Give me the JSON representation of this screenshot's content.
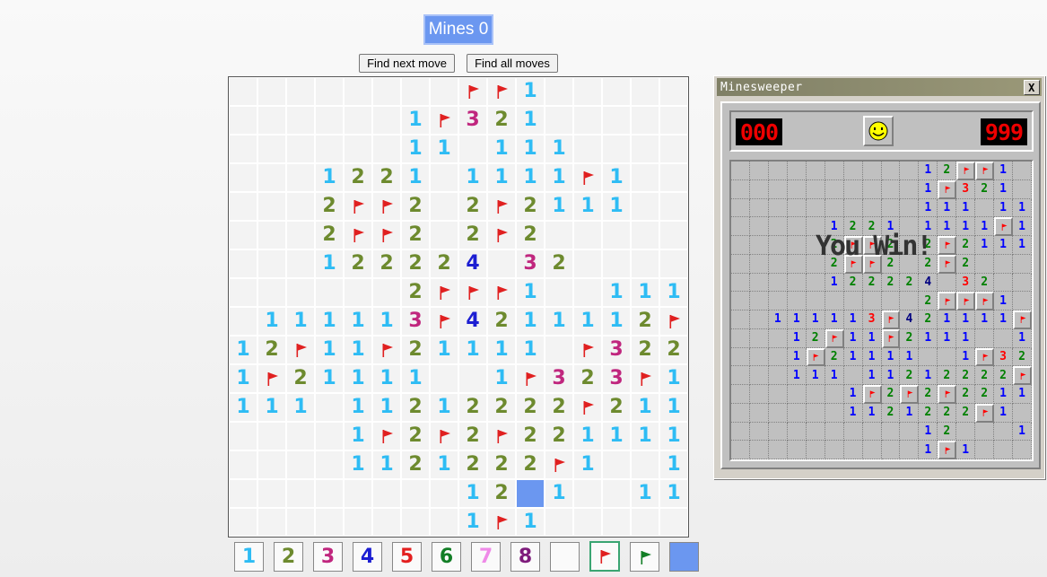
{
  "header": {
    "mines_label": "Mines 0",
    "find_next_label": "Find next move",
    "find_all_label": "Find all moves"
  },
  "colors": {
    "1": "#2ebcf4",
    "2": "#6d8a2e",
    "3": "#c0267e",
    "4": "#1c1ed2",
    "5": "#e31f1f",
    "6": "#127e26",
    "7": "#ef8ae8",
    "8": "#7e1b7b",
    "flag": "#e02020",
    "highlight": "#6b97f0",
    "selected_border": "#3aa572"
  },
  "board": [
    "......._FF1.....",
    "......1F321.....",
    "......11.111....",
    "...1221.1111F1..",
    "...2FF2.2F2111..",
    "...2FF2.2F2.....",
    "...122224.32....",
    "......2FFF1..111",
    ".111113F4211112F1",
    "12F11F21111.F322",
    "1F21111..1F323F1",
    "111.11212222F211",
    "....1F2F2F221111",
    "....1121222F1..1F",
    "........12S1..11",
    "........1F1....."
  ],
  "palette": [
    "1",
    "2",
    "3",
    "4",
    "5",
    "6",
    "7",
    "8",
    "",
    "flag-red",
    "flag-green",
    "swatch"
  ],
  "window": {
    "title": "Minesweeper",
    "close_label": "X",
    "mine_counter": "000",
    "timer": "999",
    "win_message": "You Win!"
  },
  "win_colors": {
    "1": "#0000ff",
    "2": "#008000",
    "3": "#ff0000",
    "4": "#000080"
  },
  "win_board": [
    "..........12FF1.",
    "..........1F321.",
    "..........111.111",
    ".....1221.1111F1",
    ".....2FF2.2F2111",
    ".....2FF2.2F2...",
    ".....122224.32..",
    "..........2FFF1.111",
    "..111113F421111F21",
    "...12F11F2111..1F322",
    "...1F21111..1F323F1",
    "...111.11212222F211",
    "......1F2F2F221111",
    "......1121222F1..1F",
    "..........12...1..11",
    "..........1F1......"
  ]
}
